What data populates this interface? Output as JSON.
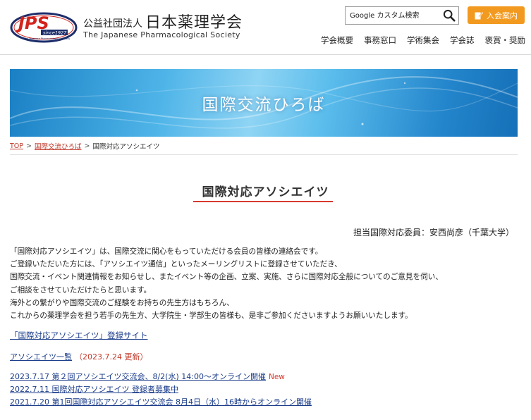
{
  "header": {
    "logo": {
      "mark_text": "JPS",
      "since_text": "since1927",
      "sub_text": "The Japanese Pharmacological Society"
    },
    "org_prefix": "公益社団法人",
    "org_name": "日本薬理学会",
    "org_name_en": "The Japanese Pharmacological Society",
    "search": {
      "placeholder": "Google カスタム検索",
      "icon": "magnifier-icon"
    },
    "join_button": {
      "label": "入会案内",
      "icon": "pencil-note-icon"
    },
    "nav": [
      "学会概要",
      "事務窓口",
      "学術集会",
      "学会誌",
      "褒賞・奨励"
    ]
  },
  "banner": {
    "title": "国際交流ひろば"
  },
  "breadcrumb": {
    "items": [
      "TOP",
      "国際交流ひろば"
    ],
    "current": "国際対応アソシエイツ",
    "separator": ">"
  },
  "page": {
    "title": "国際対応アソシエイツ",
    "committee": "担当国際対応委員：安西尚彦（千葉大学）",
    "intro": [
      "「国際対応アソシエイツ」は、国際交流に関心をもっていただける会員の皆様の連絡会です。",
      "ご登録いただいた方には、「アソシエイツ通信」といったメーリングリストに登録させていただき、",
      "国際交流・イベント関連情報をお知らせし、またイベント等の企画、立案、実施、さらに国際対応全般についてのご意見を伺い、",
      "ご相談をさせていただけたらと思います。",
      "海外との繋がりや国際交流のご経験をお持ちの先生方はもちろん、",
      "これからの薬理学会を担う若手の先生方、大学院生・学部生の皆様も、是非ご参加くださいますようお願いいたします。"
    ],
    "registration_link": "「国際対応アソシエイツ」登録サイト",
    "associates_link": "アソシエイツ一覧",
    "associates_update": "（2023.7.24 更新）",
    "news": [
      {
        "text": "2023.7.17 第２回アソシエイツ交流会、8/2(水) 14:00〜オンライン開催",
        "badge": "New"
      },
      {
        "text": "2022.7.11 国際対応アソシエイツ 登録者募集中",
        "badge": ""
      },
      {
        "text": "2021.7.20 第1回国際対応アソシエイツ交流会 8月4日（水）16時からオンライン開催",
        "badge": ""
      }
    ]
  },
  "colors": {
    "accent_red": "#d73a2f",
    "link_blue": "#1b3c8a",
    "join_orange": "#f29a1f",
    "logo_red": "#d2231c",
    "logo_navy": "#1d2e6b"
  }
}
